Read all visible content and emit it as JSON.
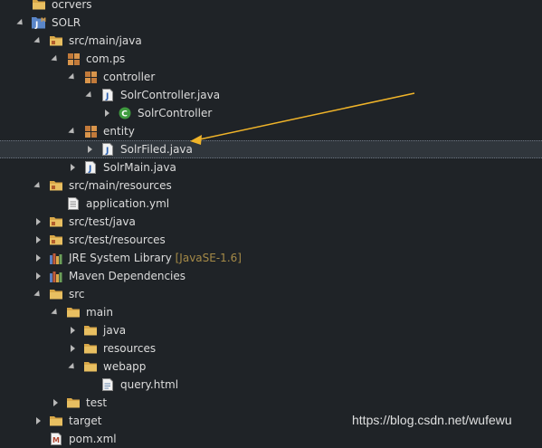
{
  "colors": {
    "background": "#1f2327",
    "selection": "#30363c",
    "text": "#dcdcdc",
    "decoration": "#a58a47",
    "annotation_arrow": "#f0b429"
  },
  "tree": {
    "nodes": [
      {
        "label": "ocrvers",
        "icon": "folder-icon",
        "state": "none",
        "depth": 0
      },
      {
        "label": "SOLR",
        "icon": "maven-project-icon",
        "state": "expanded",
        "depth": 0
      },
      {
        "label": "src/main/java",
        "icon": "source-folder-icon",
        "state": "expanded",
        "depth": 1
      },
      {
        "label": "com.ps",
        "icon": "package-icon",
        "state": "expanded",
        "depth": 2
      },
      {
        "label": "controller",
        "icon": "package-icon",
        "state": "expanded",
        "depth": 3
      },
      {
        "label": "SolrController.java",
        "icon": "java-file-icon",
        "state": "expanded",
        "depth": 4
      },
      {
        "label": "SolrController",
        "icon": "class-icon",
        "state": "collapsed",
        "depth": 5
      },
      {
        "label": "entity",
        "icon": "package-icon",
        "state": "expanded",
        "depth": 3
      },
      {
        "label": "SolrFiled.java",
        "icon": "java-file-icon",
        "state": "collapsed",
        "depth": 4,
        "selected": true
      },
      {
        "label": "SolrMain.java",
        "icon": "java-file-icon",
        "state": "collapsed",
        "depth": 3
      },
      {
        "label": "src/main/resources",
        "icon": "source-folder-icon",
        "state": "expanded",
        "depth": 1
      },
      {
        "label": "application.yml",
        "icon": "text-file-icon",
        "state": "none",
        "depth": 2
      },
      {
        "label": "src/test/java",
        "icon": "source-folder-icon",
        "state": "collapsed",
        "depth": 1
      },
      {
        "label": "src/test/resources",
        "icon": "source-folder-icon",
        "state": "collapsed",
        "depth": 1
      },
      {
        "label": "JRE System Library",
        "suffix": "[JavaSE-1.6]",
        "icon": "library-icon",
        "state": "collapsed",
        "depth": 1
      },
      {
        "label": "Maven Dependencies",
        "icon": "library-icon",
        "state": "collapsed",
        "depth": 1
      },
      {
        "label": "src",
        "icon": "folder-icon",
        "state": "expanded",
        "depth": 1
      },
      {
        "label": "main",
        "icon": "folder-icon",
        "state": "expanded",
        "depth": 2
      },
      {
        "label": "java",
        "icon": "folder-icon",
        "state": "collapsed",
        "depth": 3
      },
      {
        "label": "resources",
        "icon": "folder-icon",
        "state": "collapsed",
        "depth": 3
      },
      {
        "label": "webapp",
        "icon": "folder-icon",
        "state": "expanded",
        "depth": 3
      },
      {
        "label": "query.html",
        "icon": "html-file-icon",
        "state": "none",
        "depth": 4
      },
      {
        "label": "test",
        "icon": "folder-icon",
        "state": "collapsed",
        "depth": 2
      },
      {
        "label": "target",
        "icon": "folder-icon",
        "state": "collapsed",
        "depth": 1
      },
      {
        "label": "pom.xml",
        "icon": "maven-pom-icon",
        "state": "none",
        "depth": 1
      }
    ]
  },
  "watermark": "https://blog.csdn.net/wufewu"
}
